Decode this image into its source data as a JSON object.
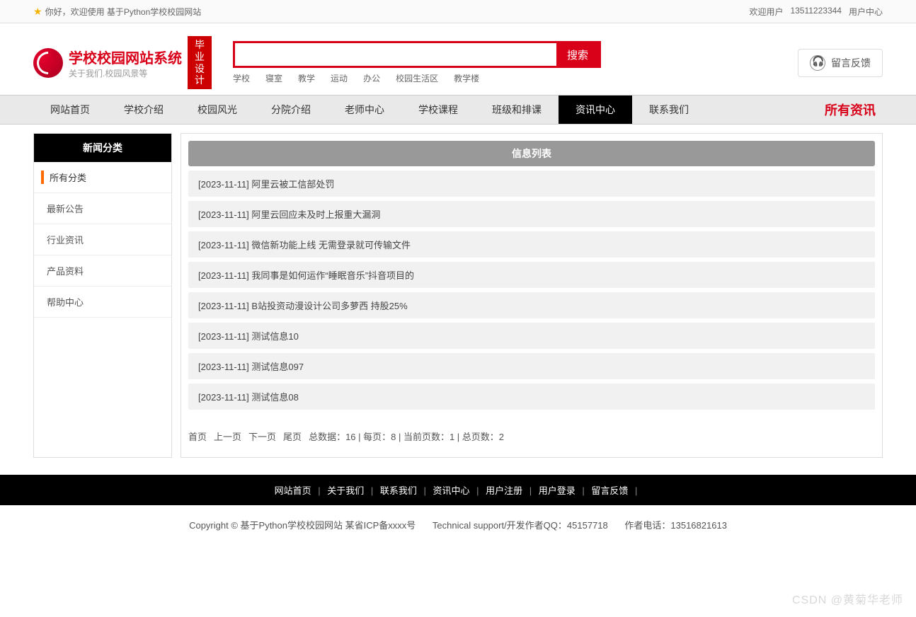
{
  "topbar": {
    "welcome": "你好，欢迎使用 基于Python学校校园网站",
    "welcome_user": "欢迎用户",
    "phone": "13511223344",
    "user_center": "用户中心"
  },
  "logo": {
    "title": "学校校园网站系统",
    "subtitle": "关于我们.校园风景等",
    "badge_line1": "毕业",
    "badge_line2": "设计"
  },
  "search": {
    "placeholder": "",
    "button": "搜索",
    "tags": [
      "学校",
      "寝室",
      "教学",
      "运动",
      "办公",
      "校园生活区",
      "教学楼"
    ]
  },
  "feedback": {
    "label": "留言反馈"
  },
  "nav": {
    "items": [
      "网站首页",
      "学校介绍",
      "校园风光",
      "分院介绍",
      "老师中心",
      "学校课程",
      "班级和排课",
      "资讯中心",
      "联系我们"
    ],
    "active_index": 7,
    "all_label": "所有资讯"
  },
  "sidebar": {
    "title": "新闻分类",
    "items": [
      "所有分类",
      "最新公告",
      "行业资讯",
      "产品资料",
      "帮助中心"
    ],
    "active_index": 0
  },
  "list": {
    "title": "信息列表",
    "rows": [
      {
        "date": "2023-11-11",
        "title": "阿里云被工信部处罚"
      },
      {
        "date": "2023-11-11",
        "title": "阿里云回应未及时上报重大漏洞"
      },
      {
        "date": "2023-11-11",
        "title": "微信新功能上线 无需登录就可传输文件"
      },
      {
        "date": "2023-11-11",
        "title": "我同事是如何运作“睡眠音乐”抖音项目的"
      },
      {
        "date": "2023-11-11",
        "title": "B站投资动漫设计公司多萝西 持股25%"
      },
      {
        "date": "2023-11-11",
        "title": "测试信息10"
      },
      {
        "date": "2023-11-11",
        "title": "测试信息097"
      },
      {
        "date": "2023-11-11",
        "title": "测试信息08"
      }
    ]
  },
  "pager": {
    "first": "首页",
    "prev": "上一页",
    "next": "下一页",
    "last": "尾页",
    "total_label": "总数据：",
    "total": 16,
    "per_page_label": "每页：",
    "per_page": 8,
    "current_label": "当前页数：",
    "current": 1,
    "pages_label": "总页数：",
    "pages": 2
  },
  "footer_nav": [
    "网站首页",
    "关于我们",
    "联系我们",
    "资讯中心",
    "用户注册",
    "用户登录",
    "留言反馈"
  ],
  "copyright": {
    "text": "Copyright © 基于Python学校校园网站 某省ICP备xxxx号",
    "tech": "Technical support/开发作者QQ：45157718",
    "author": "作者电话：13516821613"
  },
  "watermark": "CSDN @黄菊华老师"
}
